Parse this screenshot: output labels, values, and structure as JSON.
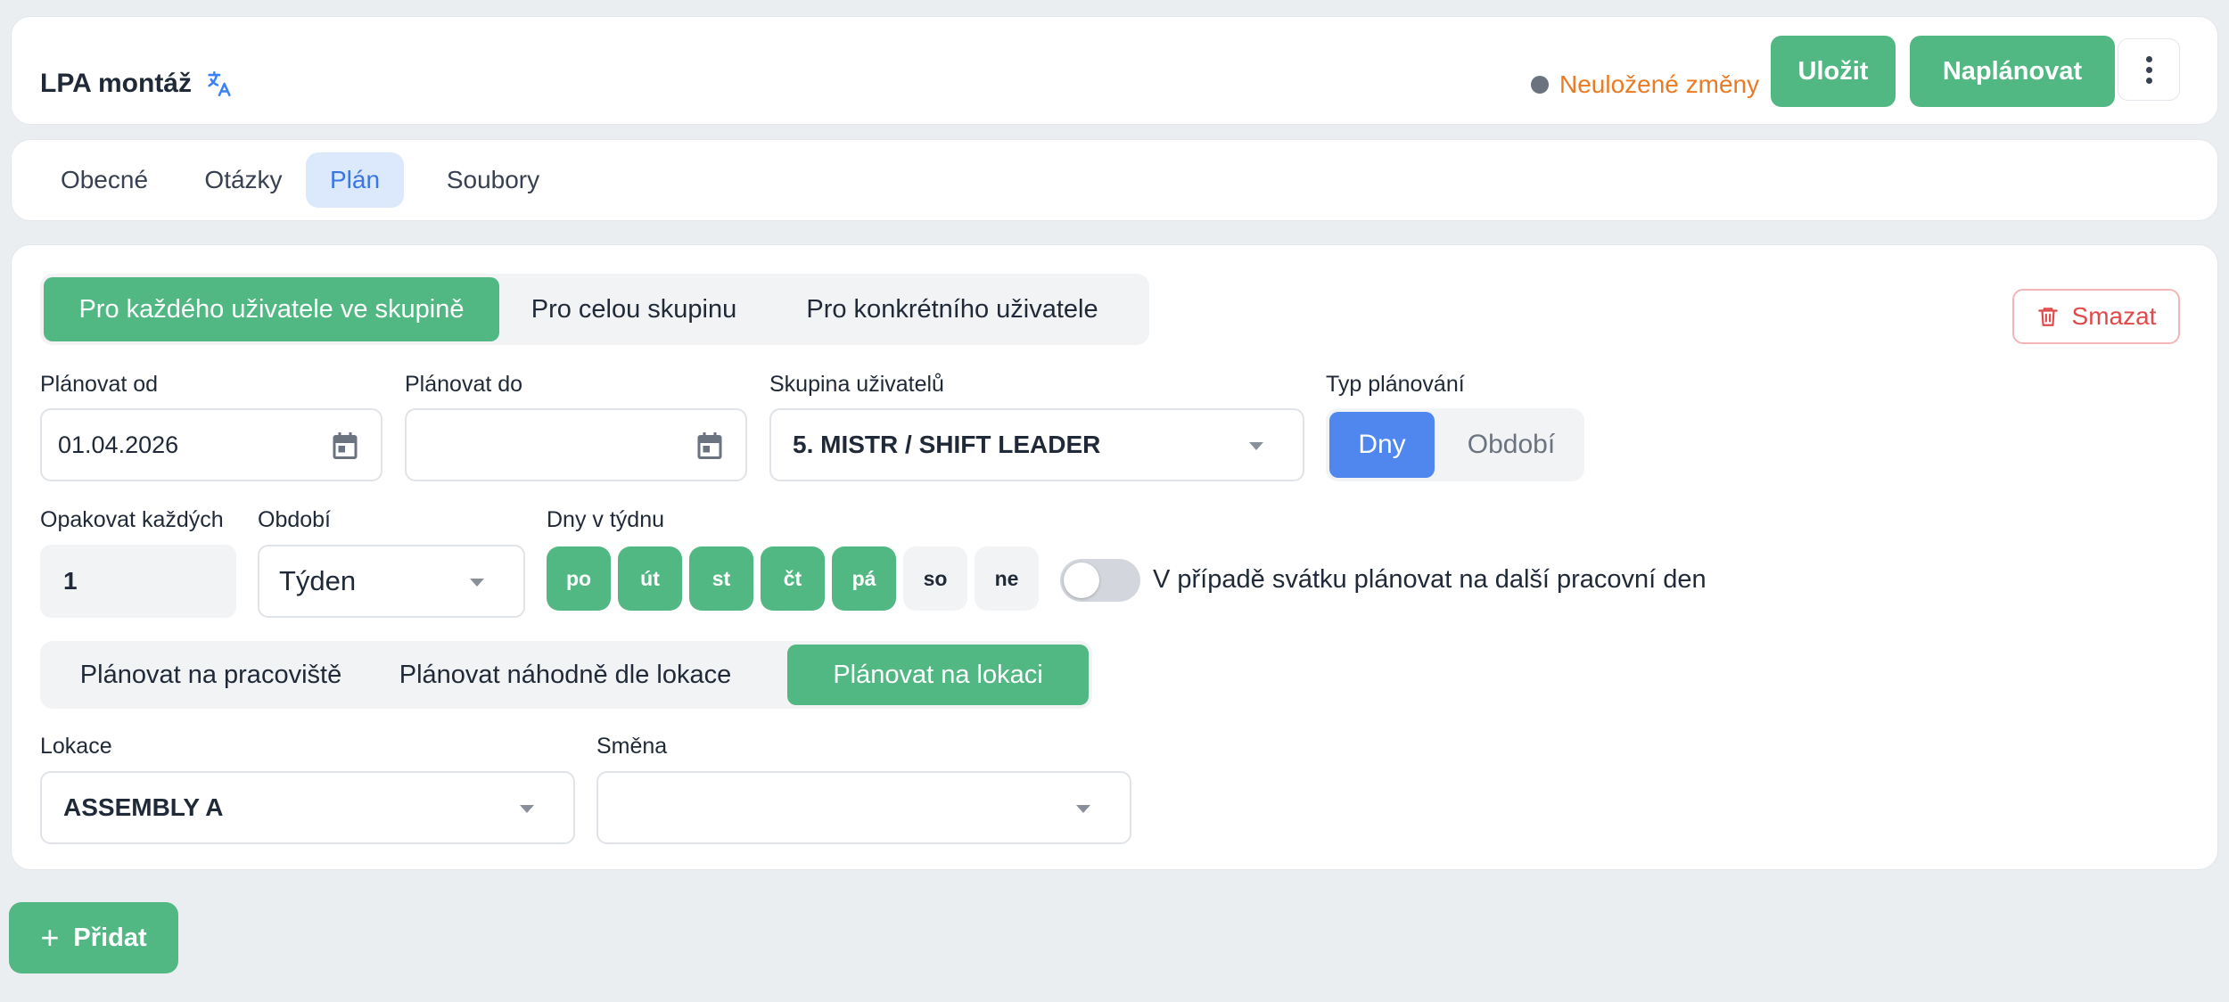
{
  "header": {
    "title": "LPA montáž",
    "unsaved_text": "Neuložené změny",
    "save_label": "Uložit",
    "schedule_label": "Naplánovat"
  },
  "tabs": [
    {
      "label": "Obecné",
      "active": false
    },
    {
      "label": "Otázky",
      "active": false
    },
    {
      "label": "Plán",
      "active": true
    },
    {
      "label": "Soubory",
      "active": false
    }
  ],
  "plan": {
    "modes": [
      {
        "label": "Pro každého uživatele ve skupině",
        "active": true
      },
      {
        "label": "Pro celou skupinu",
        "active": false
      },
      {
        "label": "Pro konkrétního uživatele",
        "active": false
      }
    ],
    "delete_label": "Smazat",
    "from_label": "Plánovat od",
    "from_value": "01.04.2026",
    "to_label": "Plánovat do",
    "to_value": "",
    "group_label": "Skupina uživatelů",
    "group_value": "5. MISTR / SHIFT LEADER",
    "type_label": "Typ plánování",
    "type_options": [
      {
        "label": "Dny",
        "active": true
      },
      {
        "label": "Období",
        "active": false
      }
    ],
    "repeat_label": "Opakovat každých",
    "repeat_value": "1",
    "period_label": "Období",
    "period_value": "Týden",
    "days_label": "Dny v týdnu",
    "days": [
      {
        "label": "po",
        "on": true
      },
      {
        "label": "út",
        "on": true
      },
      {
        "label": "st",
        "on": true
      },
      {
        "label": "čt",
        "on": true
      },
      {
        "label": "pá",
        "on": true
      },
      {
        "label": "so",
        "on": false
      },
      {
        "label": "ne",
        "on": false
      }
    ],
    "holiday_toggle_on": false,
    "holiday_label": "V případě svátku plánovat na další pracovní den",
    "location_modes": [
      {
        "label": "Plánovat na pracoviště",
        "active": false
      },
      {
        "label": "Plánovat náhodně dle lokace",
        "active": false
      },
      {
        "label": "Plánovat na lokaci",
        "active": true
      }
    ],
    "location_label": "Lokace",
    "location_value": "ASSEMBLY A",
    "shift_label": "Směna",
    "shift_value": ""
  },
  "add_label": "Přidat",
  "colors": {
    "accent_green": "#52b883",
    "accent_blue": "#4f87ee",
    "warning_orange": "#ea7a24",
    "danger_red": "#e04a4a"
  }
}
